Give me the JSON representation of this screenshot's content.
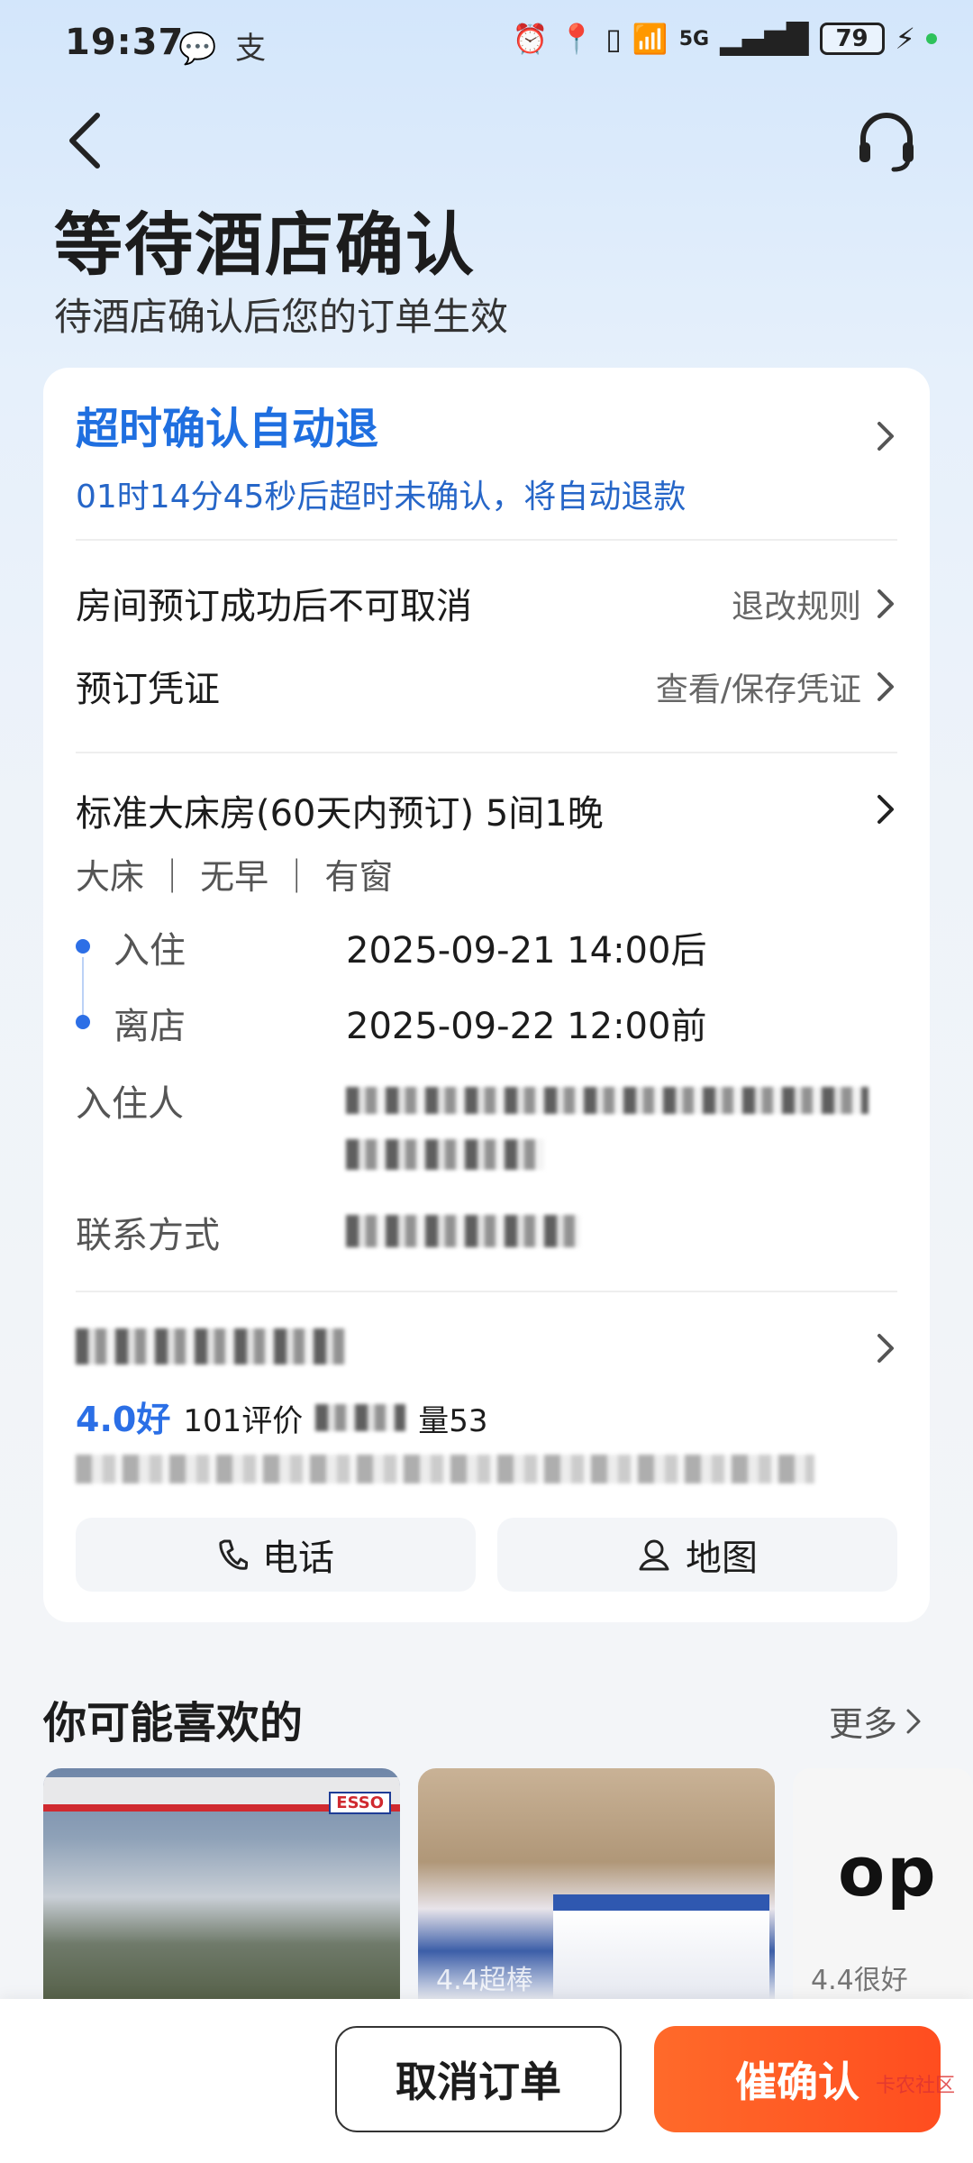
{
  "status_bar": {
    "time": "19:37",
    "app_icons": "wechat-icon alipay-icon",
    "network": "5G",
    "battery": "79"
  },
  "header": {
    "title": "等待酒店确认",
    "subtitle": "待酒店确认后您的订单生效"
  },
  "timeout": {
    "title": "超时确认自动退",
    "countdown": "01时14分45秒后超时未确认，将自动退款"
  },
  "policy": {
    "cancel_rule": "房间预订成功后不可取消",
    "cancel_link": "退改规则",
    "voucher_label": "预订凭证",
    "voucher_link": "查看/保存凭证"
  },
  "room": {
    "title": "标准大床房(60天内预订) 5间1晚",
    "tags": "大床 ｜ 无早 ｜ 有窗",
    "checkin_label": "入住",
    "checkin_value": "2025-09-21 14:00后",
    "checkout_label": "离店",
    "checkout_value": "2025-09-22 12:00前",
    "guest_label": "入住人",
    "contact_label": "联系方式"
  },
  "hotel": {
    "rating": "4.0好",
    "reviews": "101评价",
    "sales_suffix": "量53",
    "phone_button": "电话",
    "map_button": "地图"
  },
  "recommend": {
    "title": "你可能喜欢的",
    "more": "更多",
    "items": [
      {
        "tag": ""
      },
      {
        "tag": "4.4超棒"
      },
      {
        "tag": "4.4很好"
      }
    ]
  },
  "bottom": {
    "cancel": "取消订单",
    "urge": "催确认"
  },
  "watermark": "卡农社区",
  "colors": {
    "accent_blue": "#1f6fe0",
    "urge_orange": "#ff5a24"
  }
}
